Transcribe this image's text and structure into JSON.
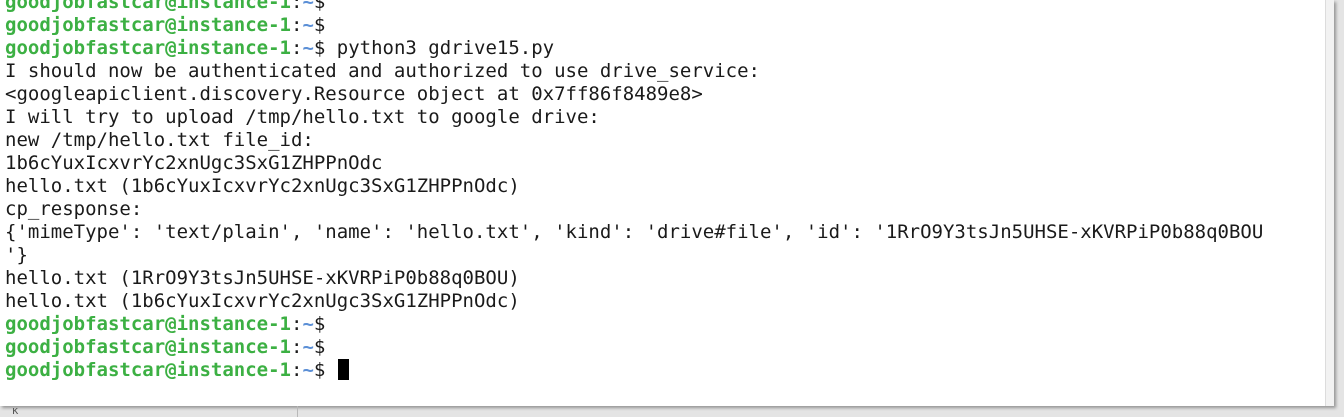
{
  "terminal": {
    "prompt": {
      "user_host": "goodjobfastcar@instance-1",
      "separator": ":",
      "path": "~",
      "symbol": "$"
    },
    "lines": [
      {
        "type": "prompt",
        "command": ""
      },
      {
        "type": "prompt",
        "command": ""
      },
      {
        "type": "prompt",
        "command": " python3 gdrive15.py"
      },
      {
        "type": "output",
        "text": "I should now be authenticated and authorized to use drive_service:"
      },
      {
        "type": "output",
        "text": "<googleapiclient.discovery.Resource object at 0x7ff86f8489e8>"
      },
      {
        "type": "output",
        "text": "I will try to upload /tmp/hello.txt to google drive:"
      },
      {
        "type": "output",
        "text": "new /tmp/hello.txt file_id:"
      },
      {
        "type": "output",
        "text": "1b6cYuxIcxvrYc2xnUgc3SxG1ZHPPnOdc"
      },
      {
        "type": "output",
        "text": "hello.txt (1b6cYuxIcxvrYc2xnUgc3SxG1ZHPPnOdc)"
      },
      {
        "type": "output",
        "text": "cp_response:"
      },
      {
        "type": "output",
        "text": "{'mimeType': 'text/plain', 'name': 'hello.txt', 'kind': 'drive#file', 'id': '1RrO9Y3tsJn5UHSE-xKVRPiP0b88q0BOU"
      },
      {
        "type": "output",
        "text": "'}"
      },
      {
        "type": "output",
        "text": "hello.txt (1RrO9Y3tsJn5UHSE-xKVRPiP0b88q0BOU)"
      },
      {
        "type": "output",
        "text": "hello.txt (1b6cYuxIcxvrYc2xnUgc3SxG1ZHPPnOdc)"
      },
      {
        "type": "prompt",
        "command": ""
      },
      {
        "type": "prompt",
        "command": ""
      },
      {
        "type": "prompt",
        "command": " ",
        "cursor": true
      }
    ]
  },
  "background": {
    "fragment_text": "κ"
  },
  "colors": {
    "user_host": "#3cb043",
    "path": "#5b8fd6",
    "text": "#1a1a1a",
    "background": "#ffffff",
    "cursor": "#000000"
  }
}
